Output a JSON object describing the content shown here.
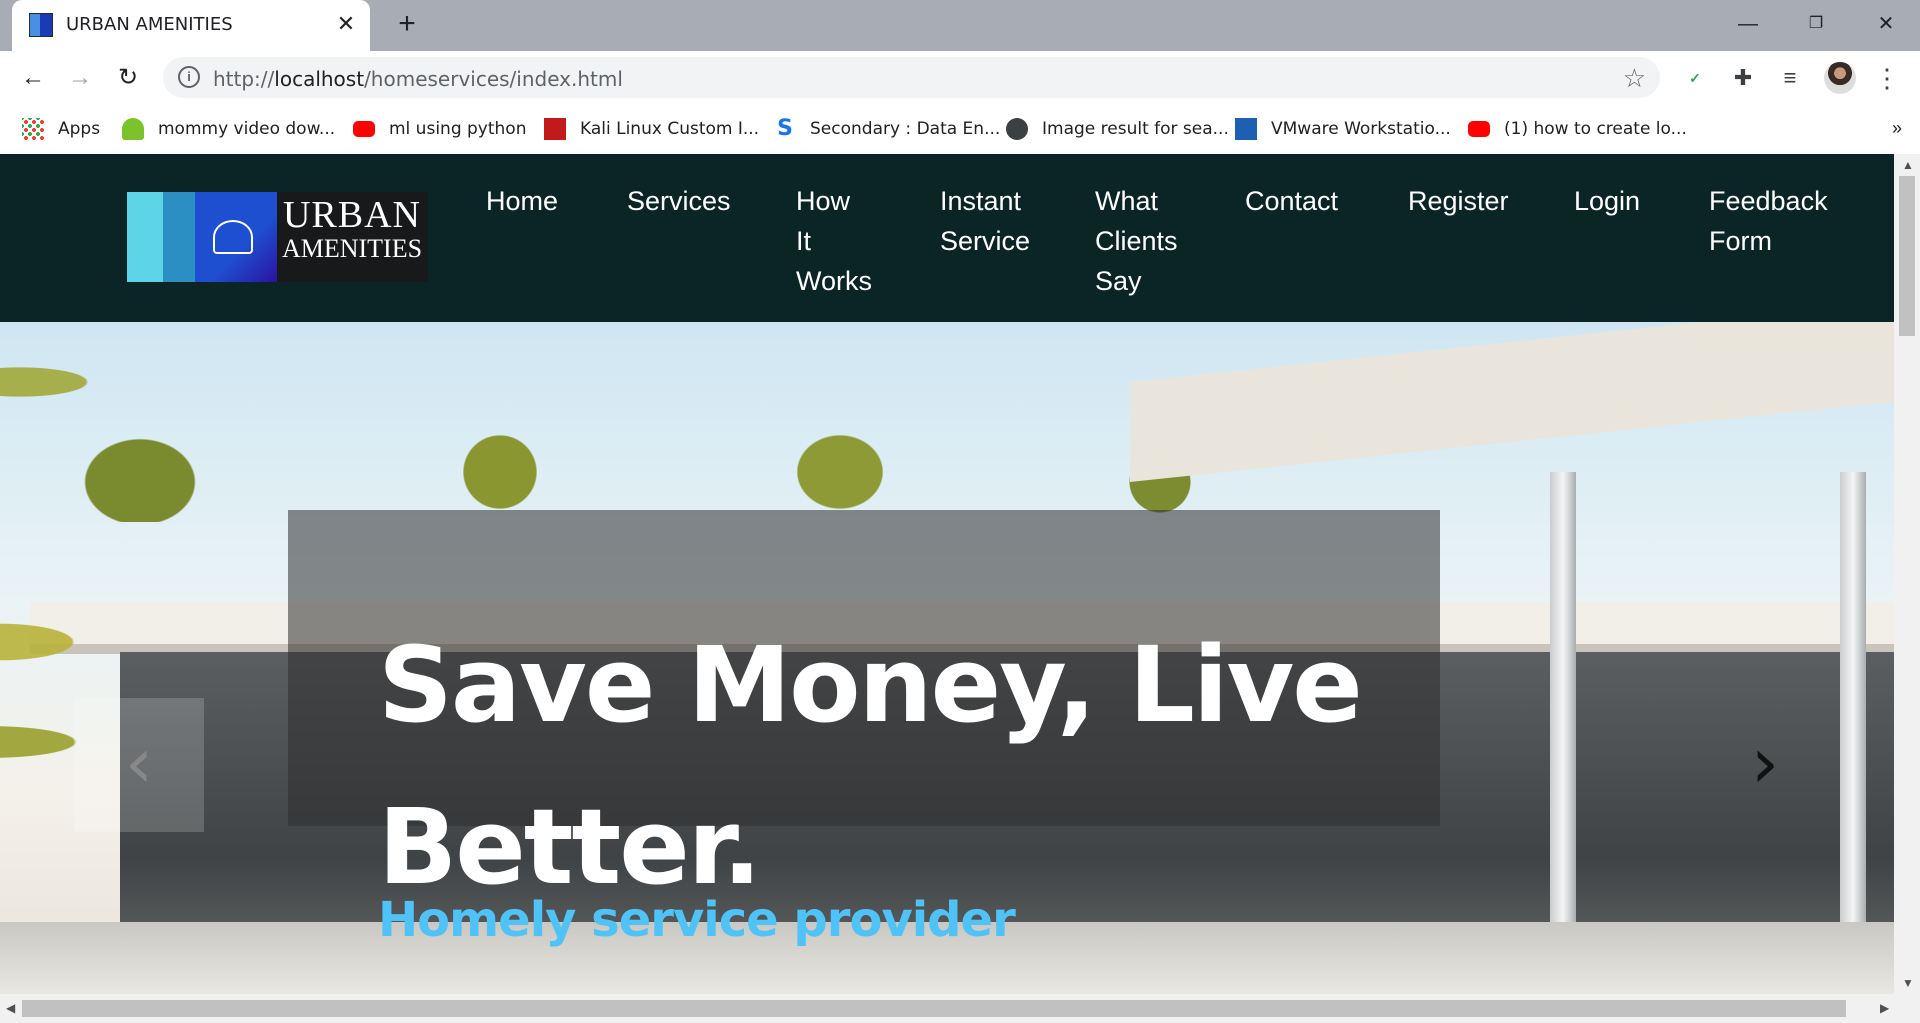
{
  "browser": {
    "tab_title": "URBAN AMENITIES",
    "tab_close": "✕",
    "new_tab": "+",
    "window_controls": {
      "minimize": "—",
      "restore": "❐",
      "close": "✕"
    },
    "nav": {
      "back": "←",
      "forward": "→",
      "reload": "↻"
    },
    "url_prefix": "http://",
    "url_host": "localhost",
    "url_path": "/homeservices/index.html",
    "star": "☆",
    "menu_dots": "⋮",
    "bookmarks": [
      {
        "label": "Apps",
        "icon": "apps-grid-icon"
      },
      {
        "label": "mommy video dow...",
        "icon": "android-icon"
      },
      {
        "label": "ml using python",
        "icon": "youtube-icon"
      },
      {
        "label": "Kali Linux Custom I...",
        "icon": "kali-icon"
      },
      {
        "label": "Secondary : Data En...",
        "icon": "s-logo-icon"
      },
      {
        "label": "Image result for sea...",
        "icon": "globe-icon"
      },
      {
        "label": "VMware Workstatio...",
        "icon": "vmware-icon"
      },
      {
        "label": "(1) how to create lo...",
        "icon": "youtube-icon"
      }
    ],
    "bookmarks_more": "»"
  },
  "site": {
    "logo": {
      "line1": "URBAN",
      "line2": "AMENITIES"
    },
    "menu": [
      "Home",
      "Services",
      "How\nIt\nWorks",
      "Instant\nService",
      "What\nClients\nSay",
      "Contact",
      "Register",
      "Login",
      "Feedback\nForm"
    ],
    "hero": {
      "title": "Save Money, Live Better.",
      "subtitle": "Homely service provider",
      "prev": "‹",
      "next": "›"
    }
  },
  "colors": {
    "navbar_bg": "#0b2527",
    "subtitle": "#4fc3f7",
    "tabstrip": "#a7acb5"
  }
}
